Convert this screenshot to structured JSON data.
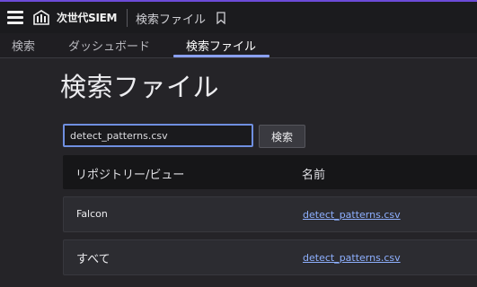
{
  "header": {
    "brand": "次世代SIEM",
    "page_name": "検索ファイル"
  },
  "tabs": [
    {
      "label": "検索",
      "active": false
    },
    {
      "label": "ダッシュボード",
      "active": false
    },
    {
      "label": "検索ファイル",
      "active": true
    }
  ],
  "main": {
    "title": "検索ファイル",
    "search": {
      "value": "detect_patterns.csv",
      "button_label": "検索"
    },
    "table": {
      "columns": [
        "リポジトリー/ビュー",
        "名前"
      ],
      "rows": [
        {
          "repo": "Falcon",
          "file": "detect_patterns.csv"
        },
        {
          "repo": "すべて",
          "file": "detect_patterns.csv"
        }
      ]
    }
  },
  "colors": {
    "accent": "#6c4bd8",
    "tab_underline": "#8aa0f0",
    "link": "#8eb0ff",
    "input_border": "#6f8fe0"
  },
  "icons": {
    "menu": "hamburger-menu-icon",
    "logo": "app-logo-icon",
    "bookmark": "bookmark-icon"
  }
}
